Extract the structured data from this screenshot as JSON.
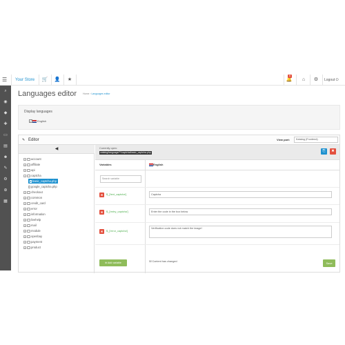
{
  "topbar": {
    "menu_icon": "☰",
    "brand": "Your Store",
    "icons": {
      "cart": "🛒",
      "user": "👤",
      "star": "★",
      "bell": "🔔",
      "home": "⌂",
      "support": "⚙"
    },
    "badge": "8",
    "logout": "Logout ⏻"
  },
  "sidebar": {
    "icons": [
      "⌕",
      "◉",
      "◆",
      "✚",
      "▭",
      "▤",
      "☻",
      "✎",
      "⚙",
      "⊕",
      "▦"
    ]
  },
  "page": {
    "title": "Languages editor",
    "breadcrumb": {
      "home": "Home",
      "sep": "›",
      "current": "Languages editor"
    }
  },
  "display_languages": {
    "label": "Display languages",
    "option": "English",
    "checked": "✓"
  },
  "editor": {
    "title": "Editor",
    "pencil": "✎",
    "view_part_label": "View part:",
    "view_part_value": "Katalog (Frontend)",
    "collapse": "◀",
    "tree": [
      {
        "label": "account",
        "type": "folder",
        "level": 0,
        "pm": "+"
      },
      {
        "label": "affiliate",
        "type": "folder",
        "level": 0,
        "pm": "+"
      },
      {
        "label": "api",
        "type": "folder",
        "level": 0,
        "pm": "+"
      },
      {
        "label": "captcha",
        "type": "folder",
        "level": 0,
        "pm": "−"
      },
      {
        "label": "basic_captcha.php",
        "type": "file",
        "level": 1,
        "active": true
      },
      {
        "label": "google_captcha.php",
        "type": "file",
        "level": 1
      },
      {
        "label": "checkout",
        "type": "folder",
        "level": 0,
        "pm": "+"
      },
      {
        "label": "common",
        "type": "folder",
        "level": 0,
        "pm": "+"
      },
      {
        "label": "credit_card",
        "type": "folder",
        "level": 0,
        "pm": "+"
      },
      {
        "label": "error",
        "type": "folder",
        "level": 0,
        "pm": "+"
      },
      {
        "label": "information",
        "type": "folder",
        "level": 0,
        "pm": "+"
      },
      {
        "label": "livehelp",
        "type": "folder",
        "level": 0,
        "pm": "+"
      },
      {
        "label": "mail",
        "type": "folder",
        "level": 0,
        "pm": "+"
      },
      {
        "label": "module",
        "type": "folder",
        "level": 0,
        "pm": "+"
      },
      {
        "label": "openbay",
        "type": "folder",
        "level": 0,
        "pm": "+"
      },
      {
        "label": "payment",
        "type": "folder",
        "level": 0,
        "pm": "+"
      },
      {
        "label": "product",
        "type": "folder",
        "level": 0,
        "pm": "+"
      }
    ],
    "current_open_label": "Currently open:",
    "current_open_path": "catalog/language/**/captcha/basic_captcha.php",
    "btn_copy": "⎘",
    "btn_close": "✖",
    "col_variables": "Variables",
    "col_language": "English",
    "search_placeholder": "Search variable",
    "rows": [
      {
        "key": "$_['text_captcha']",
        "value": "Captcha"
      },
      {
        "key": "$_['entry_captcha']",
        "value": "Enter the code in the box below"
      },
      {
        "key": "$_['error_captcha']",
        "value": "Verification code does not match the image!"
      }
    ],
    "remove_icon": "✖",
    "add_button": "⊕ Add variable",
    "content_changed": "☒ Content has changed",
    "save_button": "Save"
  }
}
